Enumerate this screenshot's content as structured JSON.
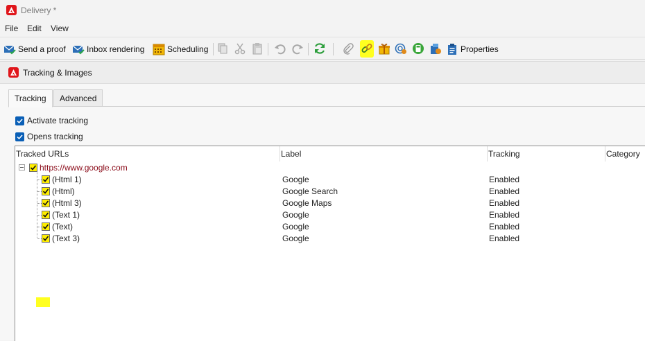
{
  "window": {
    "title": "Delivery *"
  },
  "menu": [
    "File",
    "Edit",
    "View"
  ],
  "toolbar": {
    "send_proof": "Send a proof",
    "inbox_rendering": "Inbox rendering",
    "scheduling": "Scheduling",
    "properties": "Properties",
    "icons": [
      "copy-icon",
      "cut-icon",
      "paste-icon",
      "undo-icon",
      "redo-icon",
      "refresh-icon",
      "attachment-icon",
      "link-tracking-icon",
      "gift-icon",
      "target-icon",
      "calculator-icon",
      "personalization-icon",
      "clipboard-icon"
    ]
  },
  "panel": {
    "title": "Tracking & Images",
    "tabs": [
      "Tracking",
      "Advanced"
    ],
    "activate_tracking": "Activate tracking",
    "opens_tracking": "Opens tracking"
  },
  "grid": {
    "columns": [
      "Tracked URLs",
      "Label",
      "Tracking",
      "Category"
    ],
    "parent": {
      "url": "https://www.google.com",
      "checked": true
    },
    "rows": [
      {
        "url": "(Html 1)",
        "label": "Google",
        "tracking": "Enabled",
        "category": ""
      },
      {
        "url": "(Html)",
        "label": "Google Search",
        "tracking": "Enabled",
        "category": ""
      },
      {
        "url": "(Html 3)",
        "label": "Google Maps",
        "tracking": "Enabled",
        "category": ""
      },
      {
        "url": "(Text 1)",
        "label": "Google",
        "tracking": "Enabled",
        "category": ""
      },
      {
        "url": "(Text)",
        "label": "Google",
        "tracking": "Enabled",
        "category": ""
      },
      {
        "url": "(Text 3)",
        "label": "Google",
        "tracking": "Enabled",
        "category": ""
      }
    ]
  },
  "colors": {
    "accent": "#0a5fb6",
    "brand": "#e0161b",
    "highlight": "#ffff20",
    "checkbox": "#ffee00",
    "url": "#8a0b19"
  }
}
